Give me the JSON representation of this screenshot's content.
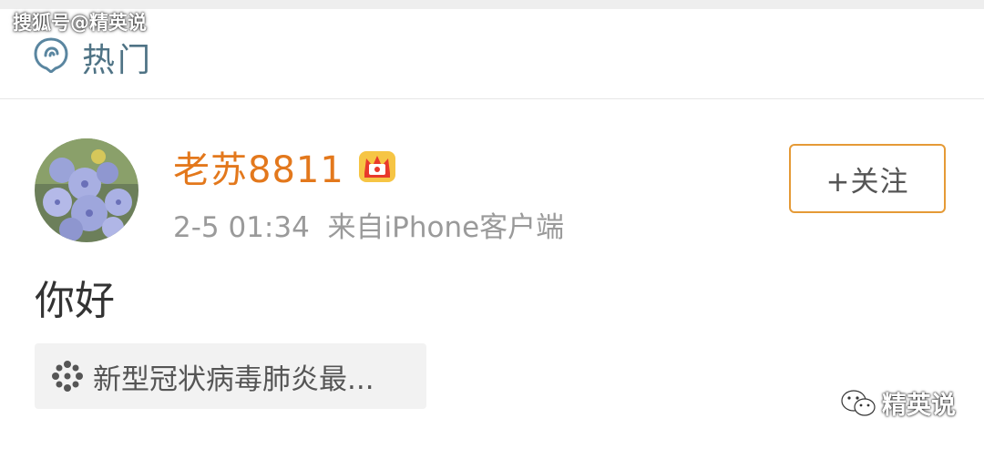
{
  "watermark_top": "搜狐号@精英说",
  "header": {
    "title": "热门",
    "icon": "hot-topic-icon"
  },
  "post": {
    "username": "老苏8811",
    "badge_icon": "crown-badge-icon",
    "timestamp": "2-5 01:34",
    "source": "来自iPhone客户端",
    "meta_text": "2-5 01:34  来自iPhone客户端",
    "follow_label": "+关注",
    "content": "你好",
    "topic": "新型冠状病毒肺炎最...",
    "topic_icon": "virus-topic-icon"
  },
  "watermark_bottom": "精英说",
  "colors": {
    "username": "#e3781c",
    "follow_border": "#e59a36",
    "header_title": "#4f7385",
    "meta": "#9a9a9a",
    "topic_bg": "#f2f2f2"
  }
}
